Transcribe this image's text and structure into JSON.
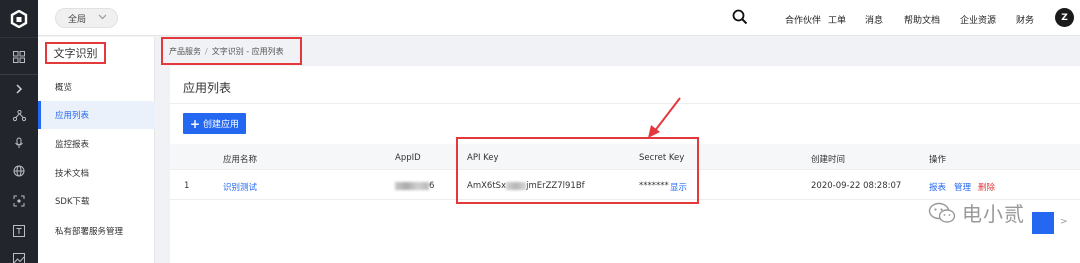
{
  "header": {
    "scope_label": "全局",
    "nav": [
      "合作伙伴",
      "工单",
      "消息",
      "帮助文档",
      "企业资源",
      "财务"
    ],
    "avatar_letter": "Z"
  },
  "rail": {
    "icons": [
      "logo-icon",
      "grid-icon",
      "expand-chevron-icon",
      "flow-icon",
      "mic-icon",
      "globe-icon",
      "scan-icon",
      "text-box-icon",
      "image-icon"
    ]
  },
  "sidebar": {
    "title": "文字识别",
    "items": [
      {
        "label": "概览",
        "active": false
      },
      {
        "label": "应用列表",
        "active": true
      },
      {
        "label": "监控报表",
        "active": false
      },
      {
        "label": "技术文档",
        "active": false
      },
      {
        "label": "SDK下载",
        "active": false
      },
      {
        "label": "私有部署服务管理",
        "active": false
      }
    ]
  },
  "breadcrumb": {
    "items": [
      "产品服务",
      "文字识别 - 应用列表"
    ],
    "separator": "/"
  },
  "main": {
    "title": "应用列表",
    "create_button": "创建应用"
  },
  "table": {
    "headers": [
      "应用名称",
      "AppID",
      "API Key",
      "Secret Key",
      "创建时间",
      "操作"
    ],
    "rows": [
      {
        "index": "1",
        "name": "识别测试",
        "appid_suffix": "6",
        "api_key_prefix": "AmX6tSx",
        "api_key_suffix": "jmErZZ7l91Bf",
        "secret_key_mask": "*******",
        "secret_show": "显示",
        "created": "2020-09-22 08:28:07",
        "actions": [
          "报表",
          "管理",
          "删除"
        ]
      }
    ]
  },
  "watermark": {
    "text": "电小贰"
  },
  "pager": {
    "next": ">"
  },
  "colors": {
    "accent": "#2468f2",
    "highlight": "#e4393c",
    "rail": "#22252b"
  }
}
